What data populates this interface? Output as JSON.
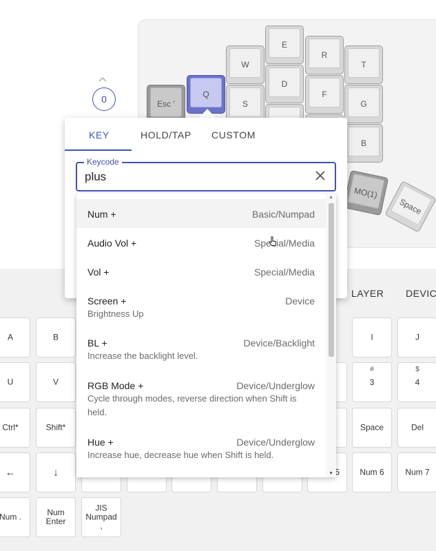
{
  "keyboard": {
    "keys": [
      "Esc '",
      "Q",
      "W",
      "E",
      "R",
      "T",
      "S",
      "D",
      "F",
      "G",
      "B",
      "MO(1)",
      "Space"
    ]
  },
  "layer": {
    "current": "0"
  },
  "popover": {
    "tabs": [
      "KEY",
      "HOLD/TAP",
      "CUSTOM"
    ],
    "field_label": "Keycode",
    "field_value": "plus"
  },
  "options": [
    {
      "name": "Num +",
      "category": "Basic/Numpad",
      "desc": ""
    },
    {
      "name": "Audio Vol +",
      "category": "Special/Media",
      "desc": ""
    },
    {
      "name": "Vol +",
      "category": "Special/Media",
      "desc": ""
    },
    {
      "name": "Screen +",
      "category": "Device",
      "desc": "Brightness Up"
    },
    {
      "name": "BL +",
      "category": "Device/Backlight",
      "desc": "Increase the backlight level."
    },
    {
      "name": "RGB Mode +",
      "category": "Device/Underglow",
      "desc": "Cycle through modes, reverse direction when Shift is held."
    },
    {
      "name": "Hue +",
      "category": "Device/Underglow",
      "desc": "Increase hue, decrease hue when Shift is held."
    }
  ],
  "picker": {
    "tabs": [
      "LAYER",
      "DEVIC"
    ],
    "row1": [
      "A",
      "B",
      "I",
      "J"
    ],
    "row2": [
      "U",
      "V",
      "3",
      "4"
    ],
    "row2_shift": [
      "#",
      "$"
    ],
    "row3": [
      "Ctrl*",
      "Shift*",
      "Space",
      "Del"
    ],
    "row4": [
      "←",
      "↓",
      "Num 6",
      "Num 7"
    ],
    "row4_partial": "5",
    "row5": [
      "Num .",
      "Num Enter",
      "JIS Numpad ,"
    ]
  },
  "colors": {
    "accent": "#3f51b5",
    "selected_key": "#c7c9f1"
  }
}
